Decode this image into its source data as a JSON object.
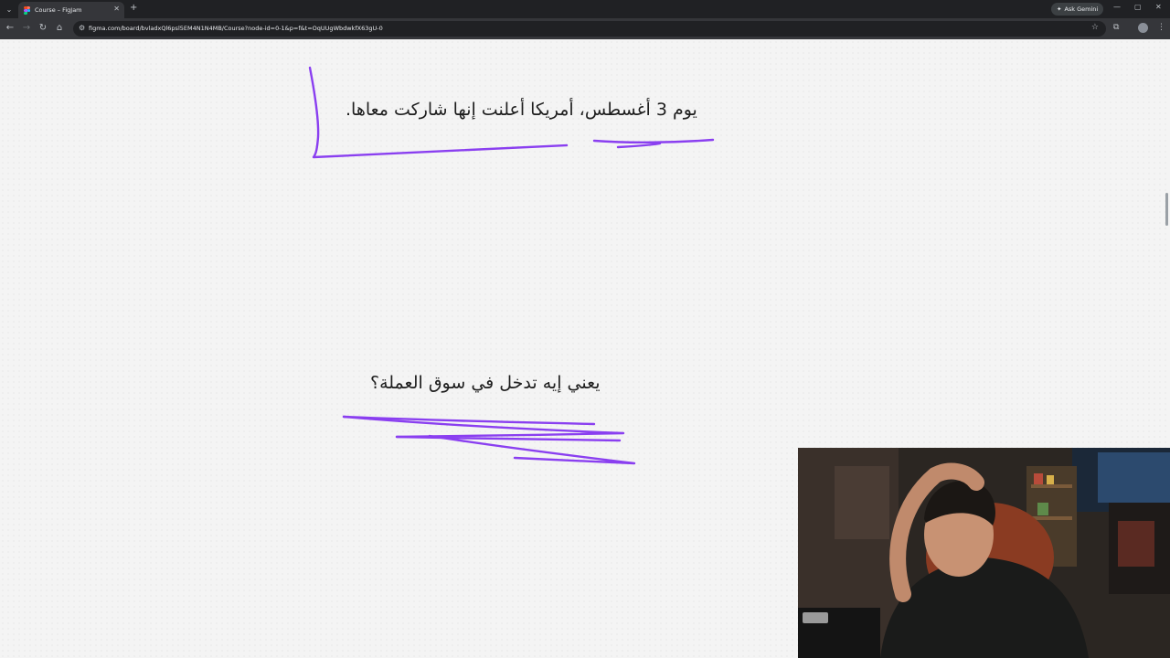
{
  "browser": {
    "tab": {
      "title": "Course – FigJam"
    },
    "url": "figma.com/board/bvladxQl6psl5EM4N1N4MB/Course?node-id=0-1&p=f&t=OqUUgWbdwkfX63gU-0",
    "ask_gemini": "Ask Gemini",
    "icons": {
      "tab_list": "chevron-down-icon",
      "close_tab": "close-icon",
      "new_tab": "plus-icon",
      "back": "arrow-left-icon",
      "forward": "arrow-right-icon",
      "reload": "reload-icon",
      "home": "home-icon",
      "site_info": "tune-icon",
      "bookmark": "star-icon",
      "extensions": "puzzle-icon",
      "profile": "avatar-icon",
      "menu": "kebab-menu-icon",
      "minimize": "minimize-icon",
      "maximize": "maximize-icon",
      "close_window": "close-icon"
    },
    "glyphs": {
      "tab_list": "⌄",
      "close_tab": "✕",
      "new_tab": "+",
      "back": "←",
      "forward": "→",
      "reload": "↻",
      "home": "⌂",
      "site_info": "⚙",
      "bookmark": "☆",
      "extensions": "⧉",
      "menu": "⋮",
      "minimize": "—",
      "maximize": "▢",
      "close_window": "✕",
      "gemini": "✦"
    }
  },
  "board": {
    "texts": [
      {
        "id": "text-1",
        "content": "يوم 3 أغسطس، أمريكا أعلنت إنها شاركت معاها."
      },
      {
        "id": "text-2",
        "content": "يعني إيه تدخل في سوق العملة؟"
      }
    ],
    "stroke_color": "#8a3ff0",
    "background_color": "#f4f4f4"
  },
  "webcam": {
    "description_visible": false
  },
  "colors": {
    "chrome_dark": "#202124",
    "chrome_toolbar": "#35363a",
    "chrome_text": "#e8eaed",
    "figjam_purple": "#8a3ff0"
  }
}
